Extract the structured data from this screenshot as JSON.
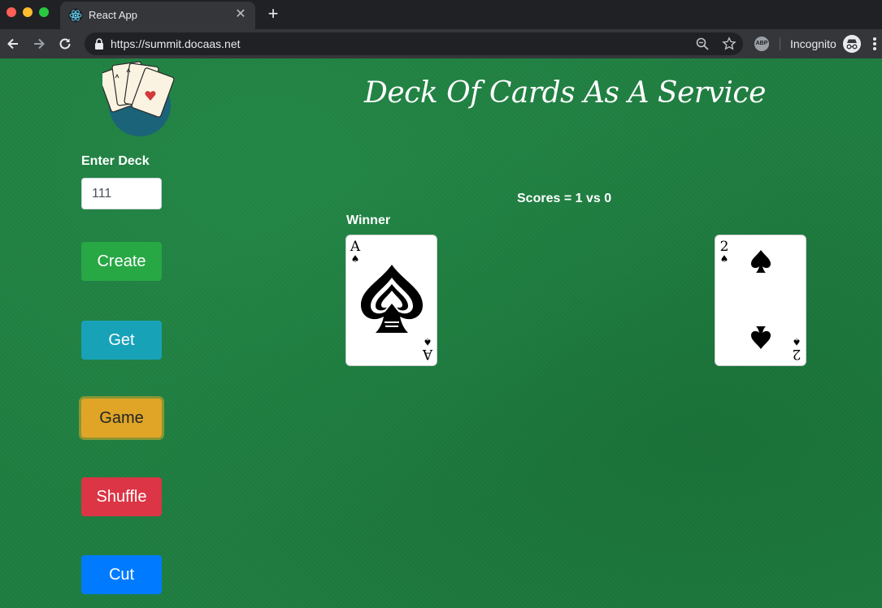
{
  "browser": {
    "tab_title": "React App",
    "tab_close": "✕",
    "new_tab": "+",
    "url": "https://summit.docaas.net",
    "abp_label": "ABP",
    "incognito_label": "Incognito"
  },
  "app": {
    "title": "Deck Of Cards As A Service",
    "deck_label": "Enter Deck",
    "deck_input_value": "111",
    "buttons": {
      "create": "Create",
      "get": "Get",
      "game": "Game",
      "shuffle": "Shuffle",
      "cut": "Cut"
    },
    "button_colors": {
      "create": "#28a745",
      "get": "#17a2b8",
      "game": "#e0a526",
      "shuffle": "#dc3545",
      "cut": "#007bff"
    },
    "scores_text": "Scores = 1 vs 0",
    "winner_label": "Winner",
    "cards": [
      {
        "rank": "A",
        "suit": "♠",
        "suit_name": "spades"
      },
      {
        "rank": "2",
        "suit": "♠",
        "suit_name": "spades"
      }
    ]
  }
}
